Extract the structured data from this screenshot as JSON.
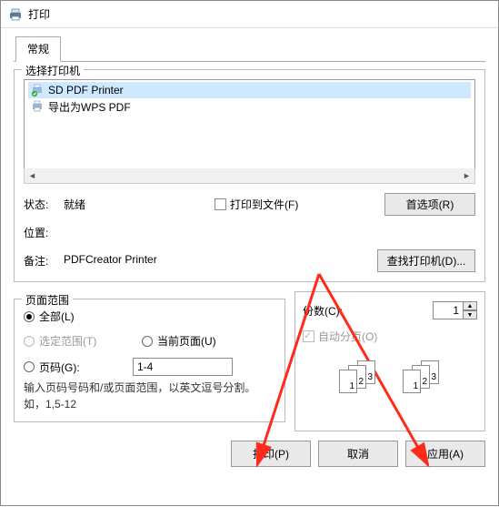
{
  "window": {
    "title": "打印"
  },
  "tabs": {
    "general": "常规"
  },
  "printer_group": {
    "legend": "选择打印机",
    "items": [
      {
        "name": "SD PDF Printer",
        "selected": true
      },
      {
        "name": "导出为WPS PDF",
        "selected": false
      }
    ],
    "status_label": "状态:",
    "status_value": "就绪",
    "location_label": "位置:",
    "location_value": "",
    "comment_label": "备注:",
    "comment_value": "PDFCreator Printer",
    "print_to_file": "打印到文件(F)",
    "preferences_btn": "首选项(R)",
    "find_printer_btn": "查找打印机(D)..."
  },
  "range_group": {
    "legend": "页面范围",
    "all": "全部(L)",
    "selection": "选定范围(T)",
    "current": "当前页面(U)",
    "pages": "页码(G):",
    "pages_value": "1-4",
    "hint": "输入页码号码和/或页面范围，以英文逗号分割。如，1,5-12"
  },
  "copies_group": {
    "copies_label": "份数(C):",
    "copies_value": "1",
    "collate": "自动分页(O)",
    "sheet_labels": {
      "a": "1",
      "b": "2",
      "c": "3"
    }
  },
  "footer": {
    "print": "打印(P)",
    "cancel": "取消",
    "apply": "应用(A)"
  }
}
